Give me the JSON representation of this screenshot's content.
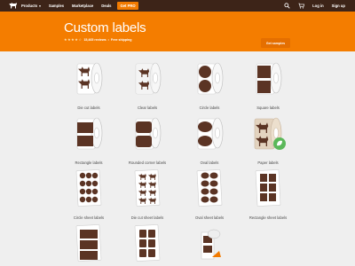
{
  "nav": {
    "products": "Products",
    "samples": "Samples",
    "marketplace": "Marketplace",
    "deals": "Deals",
    "pro": "Get PRO",
    "login": "Log in",
    "signup": "Sign up"
  },
  "hero": {
    "title": "Custom labels",
    "stars": "★★★★☆",
    "reviews": "15,465 reviews",
    "separator": "•",
    "shipping": "Free shipping",
    "cta": "Get samples"
  },
  "products": [
    {
      "label": "Die cut labels"
    },
    {
      "label": "Clear labels"
    },
    {
      "label": "Circle labels"
    },
    {
      "label": "Square labels"
    },
    {
      "label": "Rectangle labels"
    },
    {
      "label": "Rounded corner labels"
    },
    {
      "label": "Oval labels"
    },
    {
      "label": "Paper labels"
    },
    {
      "label": "Circle sheet labels"
    },
    {
      "label": "Die cut sheet labels"
    },
    {
      "label": "Oval sheet labels"
    },
    {
      "label": "Rectangle sheet labels"
    },
    {
      "label": ""
    },
    {
      "label": ""
    },
    {
      "label": ""
    }
  ],
  "colors": {
    "nav_bg": "#3d2418",
    "hero_bg": "#f47d00",
    "accent": "#f27a00",
    "label_brown": "#5b3424",
    "page_bg": "#efefef",
    "paper_green": "#5bb85a"
  }
}
